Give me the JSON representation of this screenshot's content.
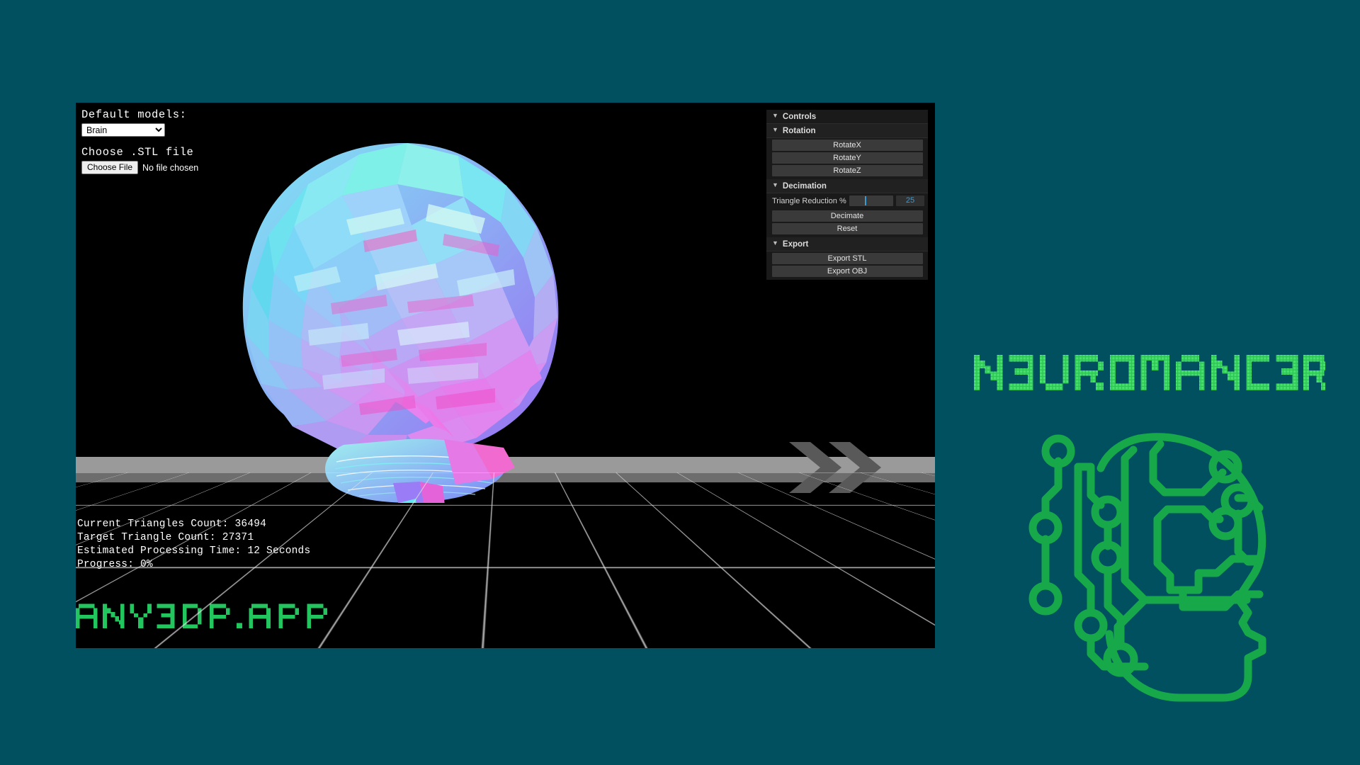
{
  "background_color": "#00505f",
  "app": {
    "viewport_bg": "#000000",
    "form": {
      "default_models_label": "Default models:",
      "model_selected": "Brain",
      "model_options": [
        "Brain"
      ],
      "choose_stl_label": "Choose .STL file",
      "choose_file_button": "Choose File",
      "file_status": "No file chosen"
    },
    "status": {
      "current_triangle_count": "Current Triangles Count: 36494",
      "target_triangle_count": "Target Triangle Count: 27371",
      "estimated_time": "Estimated Processing Time: 12 Seconds",
      "progress": "Progress: 0%",
      "current_value": 36494,
      "target_value": 27371,
      "estimated_seconds": 12,
      "progress_percent": 0
    },
    "watermark": "ANY3DP.APP",
    "watermark_color": "#22c55e",
    "chevron_color": "#595959"
  },
  "control_panel": {
    "controls_folder": "Controls",
    "rotation": {
      "title": "Rotation",
      "buttons": [
        "RotateX",
        "RotateY",
        "RotateZ"
      ]
    },
    "decimation": {
      "title": "Decimation",
      "slider_label": "Triangle Reduction %",
      "slider_value": "25",
      "slider_percent": 35,
      "buttons": [
        "Decimate",
        "Reset"
      ]
    },
    "export": {
      "title": "Export",
      "buttons": [
        "Export STL",
        "Export OBJ"
      ]
    },
    "accent_color": "#3a9bd4"
  },
  "brand": {
    "wordmark": "N3UROMANC3R",
    "wordmark_color": "#2dc653",
    "logo_name": "circuit-head-logo",
    "logo_color": "#17a84a"
  }
}
